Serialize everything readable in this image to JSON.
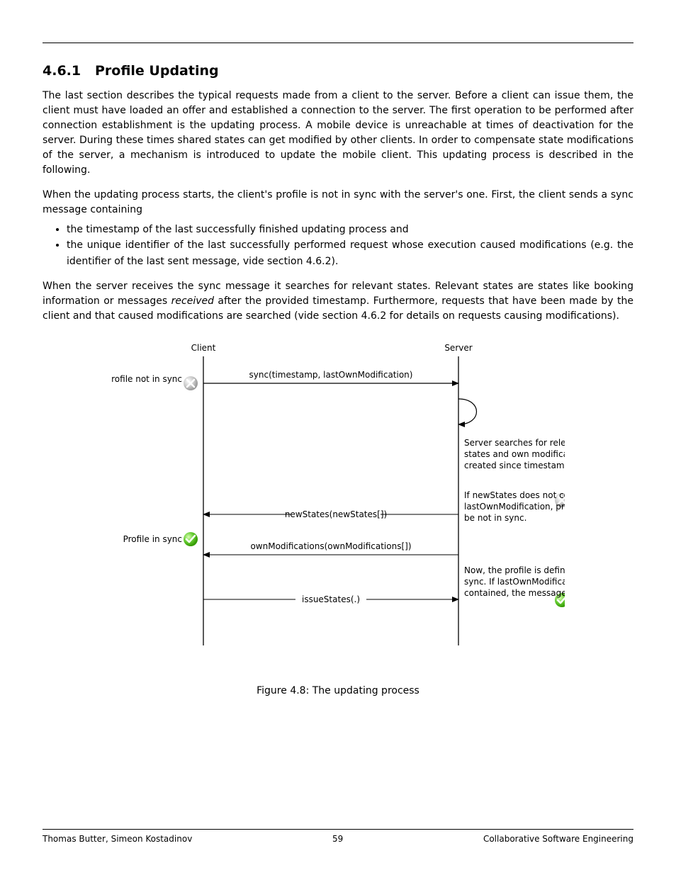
{
  "header": {
    "section_num": "4.6.1",
    "section_title": "Profile Updating"
  },
  "para1": "The last section describes the typical requests made from a client to the server. Before a client can issue them, the client must have loaded an offer and established a connection to the server. The first operation to be performed after connection establishment is the updating process. A mobile device is unreachable at times of deactivation for the server. During these times shared states can get modified by other clients. In order to compensate state modifications of the server, a mechanism is introduced to update the mobile client. This updating process is described in the following.",
  "para2": "When the updating process starts, the client's profile is not in sync with the server's one. First, the client sends a sync message containing",
  "bullets": {
    "b1": "the timestamp of the last successfully finished updating process and",
    "b2": "the unique identifier of the last successfully performed request whose execution caused modifications (e.g. the identifier of the last sent message, vide section 4.6.2)."
  },
  "para3_a": "When the server receives the sync message it searches for relevant states. Relevant states are states like booking information or messages ",
  "para3_em": "received",
  "para3_b": " after the provided timestamp. Furthermore, requests that have been made by the client and that caused modifications are searched (vide section 4.6.2 for details on requests causing modifications).",
  "diagram": {
    "client_header": "Client",
    "server_header": "Server",
    "left_annot_top": "Profile not in sync",
    "left_annot_bottom": "Profile in sync",
    "msg_sync": "sync(timestamp, lastOwnModification)",
    "self_note_1": "Server searches for relevant",
    "self_note_2": "states and own modifications",
    "self_note_3": "created since timestamp.",
    "msg_newstates": "newStates(newStates[])",
    "right_annot_top_1": "If newStates does not contain the",
    "right_annot_top_2": "lastOwnModification, profile may",
    "right_annot_top_3": "be not in sync.",
    "msg_ownmods": "ownModifications(ownModifications[])",
    "right_annot_bot_1": "Now, the profile is definitely in",
    "right_annot_bot_2": "sync. If lastOwnModification is",
    "right_annot_bot_3": "contained, the message is ignored.",
    "msg_issue": "issueStates(.)",
    "caption": "Figure 4.8: The updating process",
    "icons": {
      "not_sync": "not-sync",
      "in_sync": "in-sync"
    }
  },
  "footer": {
    "left": "Thomas Butter, Simeon Kostadinov",
    "center": "59",
    "right": "Collaborative Software Engineering"
  }
}
